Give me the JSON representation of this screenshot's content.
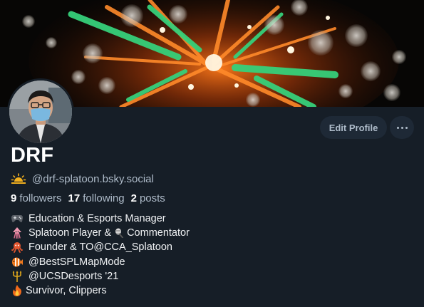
{
  "profile": {
    "display_name": "DRF",
    "handle": "@drf-splatoon.bsky.social",
    "stats": {
      "followers_count": "9",
      "followers_label": "followers",
      "following_count": "17",
      "following_label": "following",
      "posts_count": "2",
      "posts_label": "posts"
    }
  },
  "actions": {
    "edit_profile_label": "Edit Profile",
    "more_icon": "ellipsis-horizontal-icon"
  },
  "bio": {
    "line1": {
      "icon": "game-controller-icon",
      "text": "Education & Esports Manager"
    },
    "line2": {
      "icon": "squid-icon",
      "text_before": "Splatoon Player & ",
      "inline_icon": "microphone-icon",
      "text_after": "Commentator"
    },
    "line3": {
      "icon": "octopus-icon",
      "text": "Founder & TO ",
      "mention": "@CCA_Splatoon"
    },
    "line4": {
      "icon": "fish-icon",
      "mention": "@BestSPLMapMode"
    },
    "line5": {
      "icon": "trident-icon",
      "mention": "@UCSDesports",
      "text_after": " '21"
    },
    "line6": {
      "icon": "fire-icon",
      "text": "Survivor, Clippers"
    }
  },
  "colors": {
    "background": "#161e27",
    "button_bg": "#1e2936",
    "secondary_text": "#aebbc9",
    "primary_text": "#ffffff"
  }
}
